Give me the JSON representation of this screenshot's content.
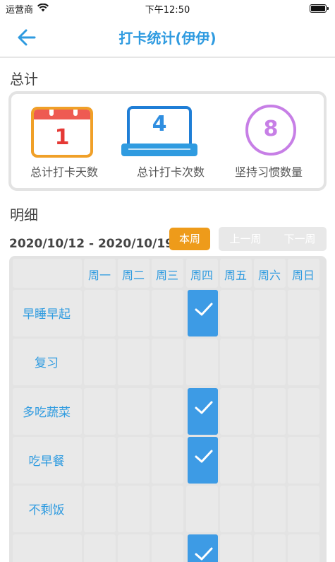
{
  "status_bar": {
    "carrier": "运营商",
    "time": "下午12:50"
  },
  "nav": {
    "title": "打卡统计(伊伊)"
  },
  "summary": {
    "section_title": "总计",
    "total_days": {
      "value": "1",
      "label": "总计打卡天数"
    },
    "total_checkins": {
      "value": "4",
      "label": "总计打卡次数"
    },
    "habits_kept": {
      "value": "8",
      "label": "坚持习惯数量"
    }
  },
  "detail": {
    "section_title": "明细",
    "date_range": "2020/10/12 - 2020/10/19",
    "this_week_label": "本周",
    "prev_week_label": "上一周",
    "next_week_label": "下一周",
    "weekdays": [
      "周一",
      "周二",
      "周三",
      "周四",
      "周五",
      "周六",
      "周日"
    ],
    "habits": [
      {
        "name": "早睡早起",
        "checked": [
          false,
          false,
          false,
          true,
          false,
          false,
          false
        ]
      },
      {
        "name": "复习",
        "checked": [
          false,
          false,
          false,
          false,
          false,
          false,
          false
        ]
      },
      {
        "name": "多吃蔬菜",
        "checked": [
          false,
          false,
          false,
          true,
          false,
          false,
          false
        ]
      },
      {
        "name": "吃早餐",
        "checked": [
          false,
          false,
          false,
          true,
          false,
          false,
          false
        ]
      },
      {
        "name": "不剩饭",
        "checked": [
          false,
          false,
          false,
          false,
          false,
          false,
          false
        ]
      },
      {
        "name": "",
        "checked": [
          false,
          false,
          false,
          true,
          false,
          false,
          false
        ]
      }
    ]
  },
  "colors": {
    "accent": "#2f9be0",
    "orange": "#ee9b1a",
    "check": "#3d9be5",
    "purple": "#c77fe6",
    "red": "#e53935"
  }
}
